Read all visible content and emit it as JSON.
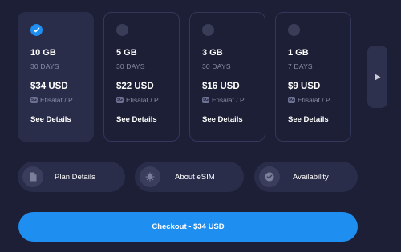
{
  "plans": [
    {
      "data": "10 GB",
      "days": "30 DAYS",
      "price": "$34 USD",
      "network_badge": "5G",
      "carrier": "Etisalat / P...",
      "details_label": "See Details",
      "selected": true
    },
    {
      "data": "5 GB",
      "days": "30 DAYS",
      "price": "$22 USD",
      "network_badge": "5G",
      "carrier": "Etisalat / P...",
      "details_label": "See Details",
      "selected": false
    },
    {
      "data": "3 GB",
      "days": "30 DAYS",
      "price": "$16 USD",
      "network_badge": "5G",
      "carrier": "Etisalat / P...",
      "details_label": "See Details",
      "selected": false
    },
    {
      "data": "1 GB",
      "days": "7 DAYS",
      "price": "$9 USD",
      "network_badge": "5G",
      "carrier": "Etisalat / P...",
      "details_label": "See Details",
      "selected": false
    }
  ],
  "info_buttons": [
    {
      "label": "Plan Details",
      "icon": "document-icon"
    },
    {
      "label": "About eSIM",
      "icon": "sim-chip-icon"
    },
    {
      "label": "Availability",
      "icon": "check-circle-icon"
    }
  ],
  "checkout": {
    "label": "Checkout - $34 USD"
  },
  "colors": {
    "background": "#1c1f35",
    "card_selected": "#2a2d4a",
    "accent": "#1e8ef0",
    "muted_text": "#8a8da6"
  }
}
